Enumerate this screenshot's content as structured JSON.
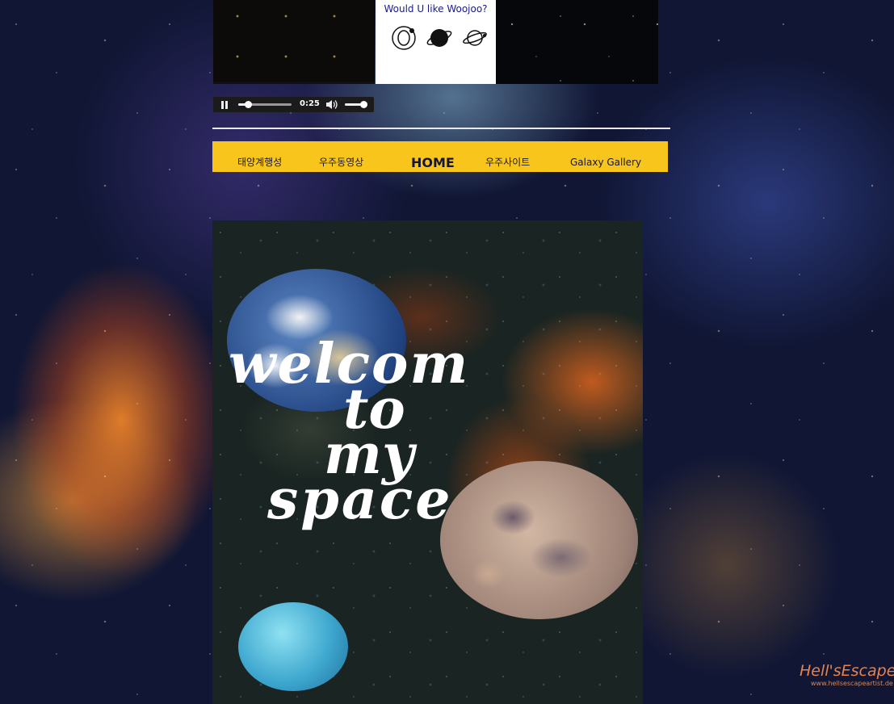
{
  "promo": {
    "title": "Would U like Woojoo?",
    "icons": [
      "orbit-planet-icon",
      "saturn-icon",
      "ringed-planet-icon"
    ]
  },
  "audio_player": {
    "time": "0:25",
    "progress_fraction": 0.18,
    "volume_fraction": 0.9
  },
  "nav": {
    "items": [
      {
        "label": "태양계행성"
      },
      {
        "label": "우주동영상"
      },
      {
        "label": "HOME"
      },
      {
        "label": "우주사이트"
      },
      {
        "label": "Galaxy Gallery"
      }
    ]
  },
  "hero": {
    "line1": "welcom",
    "line2": "to",
    "line3": "my",
    "line4": "space"
  },
  "watermark": {
    "brand": "Hell'sEscape",
    "url": "www.hellsescapeartist.de"
  },
  "colors": {
    "nav_bg": "#f7c51c",
    "nav_text": "#16163a",
    "promo_title": "#1a1a8a"
  }
}
